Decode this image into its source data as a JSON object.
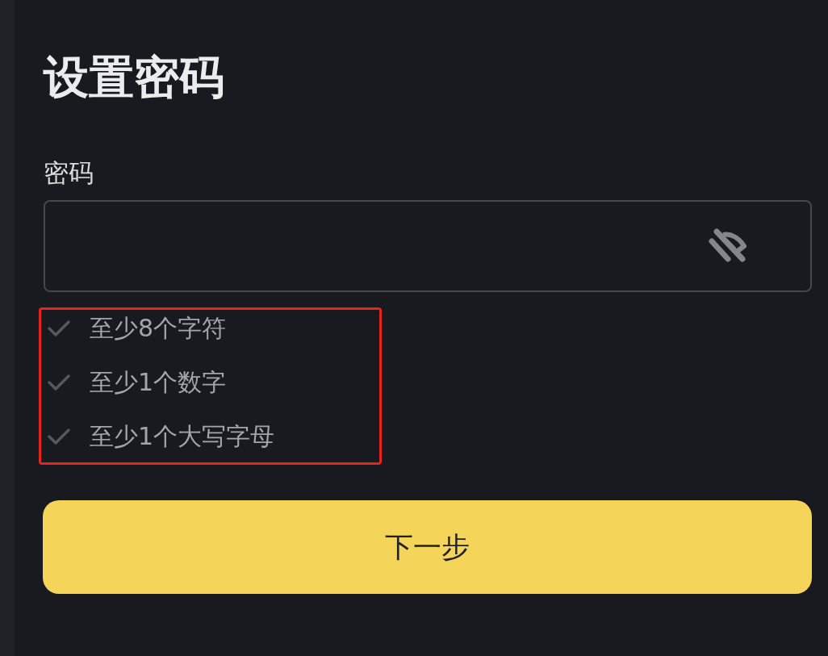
{
  "title": "设置密码",
  "password_field": {
    "label": "密码",
    "visible": false
  },
  "requirements": {
    "highlighted": true,
    "items": [
      {
        "text": "至少8个字符",
        "met": false
      },
      {
        "text": "至少1个数字",
        "met": false
      },
      {
        "text": "至少1个大写字母",
        "met": false
      }
    ]
  },
  "next_button": {
    "label": "下一步"
  }
}
